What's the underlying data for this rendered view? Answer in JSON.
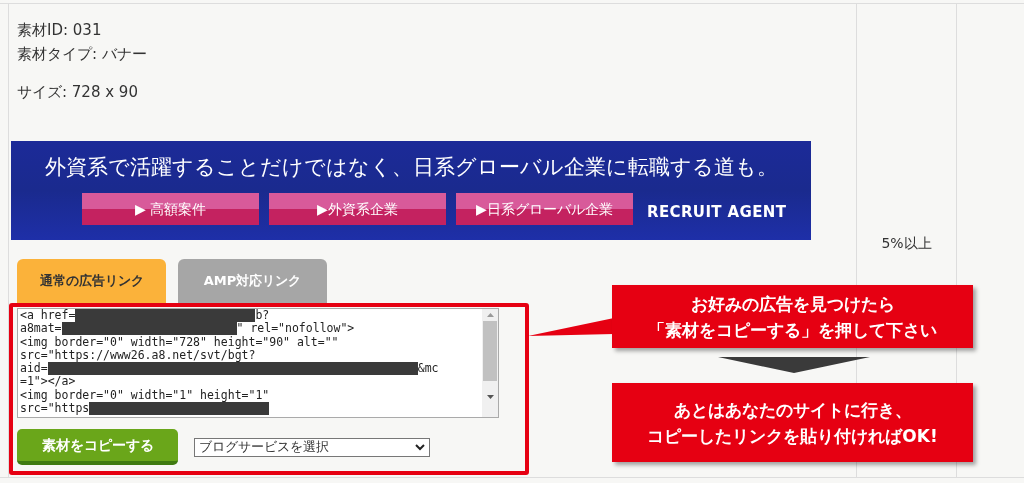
{
  "material": {
    "id_line": "素材ID: 031",
    "type_line": "素材タイプ: バナー",
    "size_line": "サイズ: 728 x 90"
  },
  "banner": {
    "headline": "外資系で活躍することだけではなく、日系グローバル企業に転職する道も。",
    "buttons": [
      "▶ 高額案件",
      "▶外資系企業",
      "▶日系グローバル企業"
    ],
    "brand": "RECRUIT AGENT"
  },
  "tabs": [
    {
      "label": "通常の広告リンク",
      "selected": true
    },
    {
      "label": "AMP対応リンク",
      "selected": false
    }
  ],
  "code": {
    "lines": [
      [
        {
          "kind": "text",
          "text": "<a href="
        },
        {
          "kind": "redacted"
        },
        {
          "kind": "text",
          "text": "b?"
        }
      ],
      [
        {
          "kind": "text",
          "text": "a8mat="
        },
        {
          "kind": "redacted"
        },
        {
          "kind": "text",
          "text": "\" rel=\"nofollow\">"
        }
      ],
      [
        {
          "kind": "text",
          "text": "<img border=\"0\" width=\"728\" height=\"90\" alt=\"\""
        }
      ],
      [
        {
          "kind": "text",
          "text": "src=\"https://www26.a8.net/svt/bgt?"
        }
      ],
      [
        {
          "kind": "text",
          "text": "aid="
        },
        {
          "kind": "redacted"
        },
        {
          "kind": "text",
          "text": "&mc"
        }
      ],
      [
        {
          "kind": "text",
          "text": "=1\"></a>"
        }
      ],
      [
        {
          "kind": "text",
          "text": "<img border=\"0\" width=\"1\" height=\"1\""
        }
      ],
      [
        {
          "kind": "text",
          "text": "src=\"https"
        },
        {
          "kind": "redacted"
        }
      ]
    ]
  },
  "copy_button": "素材をコピーする",
  "select": {
    "value": "ブログサービスを選択"
  },
  "reward": "5%以上",
  "callouts": [
    {
      "lines": [
        "お好みの広告を見つけたら",
        "「素材をコピーする」を押して下さい"
      ]
    },
    {
      "lines": [
        "あとはあなたのサイトに行き、",
        "コピーしたリンクを貼り付ければOK!"
      ]
    }
  ]
}
